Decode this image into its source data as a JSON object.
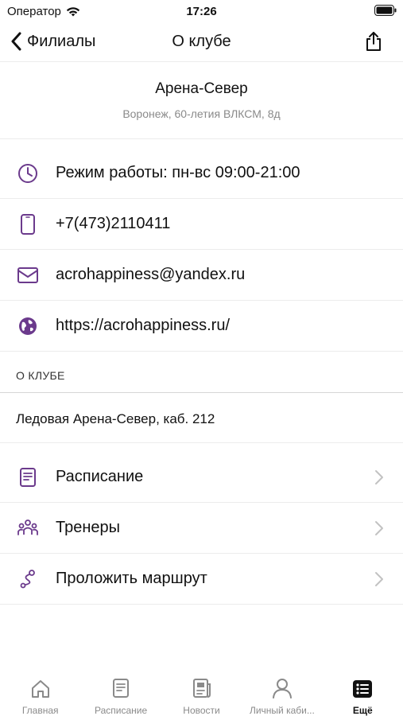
{
  "status_bar": {
    "carrier": "Оператор",
    "time": "17:26"
  },
  "nav": {
    "back_label": "Филиалы",
    "title": "О клубе"
  },
  "club": {
    "name": "Арена-Север",
    "address": "Воронеж, 60-летия ВЛКСМ, 8д"
  },
  "info": {
    "hours": "Режим работы: пн-вс 09:00-21:00",
    "phone": "+7(473)2110411",
    "email": "acrohappiness@yandex.ru",
    "website": "https://acrohappiness.ru/"
  },
  "about_section": {
    "header": "О КЛУБЕ",
    "text": "Ледовая Арена-Север, каб. 212"
  },
  "menu": {
    "schedule": "Расписание",
    "trainers": "Тренеры",
    "route": "Проложить маршрут"
  },
  "tabs": {
    "home": "Главная",
    "schedule": "Расписание",
    "news": "Новости",
    "account": "Личный каби...",
    "more": "Ещё"
  },
  "colors": {
    "accent": "#6b3a8c",
    "icon_gray": "#8a8a8a",
    "divider": "#ececec"
  }
}
